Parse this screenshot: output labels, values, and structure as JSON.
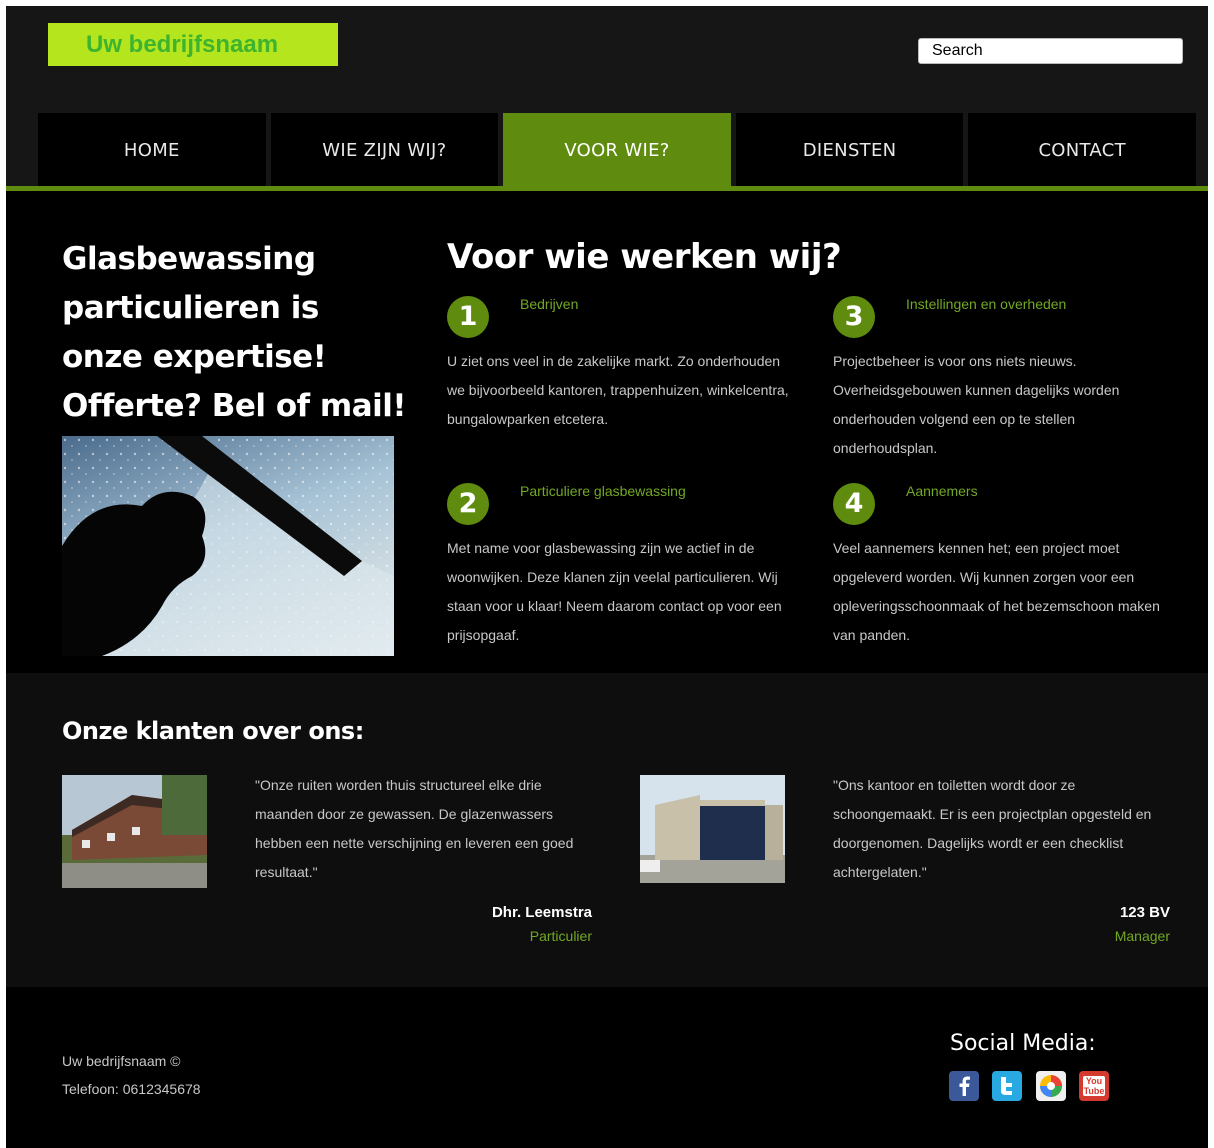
{
  "header": {
    "logo_text": "Uw bedrijfsnaam",
    "search_placeholder": "Search"
  },
  "nav": {
    "items": [
      {
        "label": "HOME",
        "active": false
      },
      {
        "label": "WIE ZIJN WIJ?",
        "active": false
      },
      {
        "label": "VOOR WIE?",
        "active": true
      },
      {
        "label": "DIENSTEN",
        "active": false
      },
      {
        "label": "CONTACT",
        "active": false
      }
    ]
  },
  "intro": {
    "title": "Glasbewassing particulieren is onze expertise! Offerte? Bel of mail!"
  },
  "services": {
    "title": "Voor wie werken wij?",
    "items": [
      {
        "number": "1",
        "title": "Bedrijven",
        "text": "U ziet ons veel in de zakelijke markt. Zo onderhouden we bijvoorbeeld kantoren, trappenhuizen, winkelcentra, bungalowparken etcetera."
      },
      {
        "number": "2",
        "title": "Particuliere glasbewassing",
        "text": "Met name voor glasbewassing zijn we actief in de woonwijken. Deze klanen zijn veelal particulieren. Wij staan voor u klaar! Neem daarom contact op voor een prijsopgaaf."
      },
      {
        "number": "3",
        "title": "Instellingen en overheden",
        "text": "Projectbeheer is voor ons niets nieuws. Overheidsgebouwen kunnen dagelijks worden onderhouden volgend een op te stellen onderhoudsplan."
      },
      {
        "number": "4",
        "title": "Aannemers",
        "text": "Veel aannemers kennen het; een project moet opgeleverd worden. Wij kunnen zorgen voor een opleveringsschoonmaak of het bezemschoon maken van panden."
      }
    ]
  },
  "testimonials": {
    "title": "Onze klanten over ons:",
    "items": [
      {
        "quote": "\"Onze ruiten worden thuis structureel elke drie maanden door ze gewassen. De glazenwassers hebben een nette verschijning en leveren een goed resultaat.\"",
        "name": "Dhr. Leemstra",
        "role": "Particulier"
      },
      {
        "quote": "\"Ons kantoor en toiletten wordt door ze schoongemaakt. Er is een projectplan opgesteld en doorgenomen. Dagelijks wordt er een checklist achtergelaten.\"",
        "name": "123 BV",
        "role": "Manager"
      }
    ]
  },
  "footer": {
    "company": "Uw bedrijfsnaam ©",
    "phone": "Telefoon: 0612345678",
    "social_title": "Social Media:",
    "social_icons": [
      "facebook-icon",
      "twitter-icon",
      "picasa-icon",
      "youtube-icon"
    ],
    "youtube_text": "You Tube"
  },
  "colors": {
    "accent_green": "#5f8c0e",
    "text_green": "#73a823",
    "logo_bg": "#b5e61d"
  }
}
